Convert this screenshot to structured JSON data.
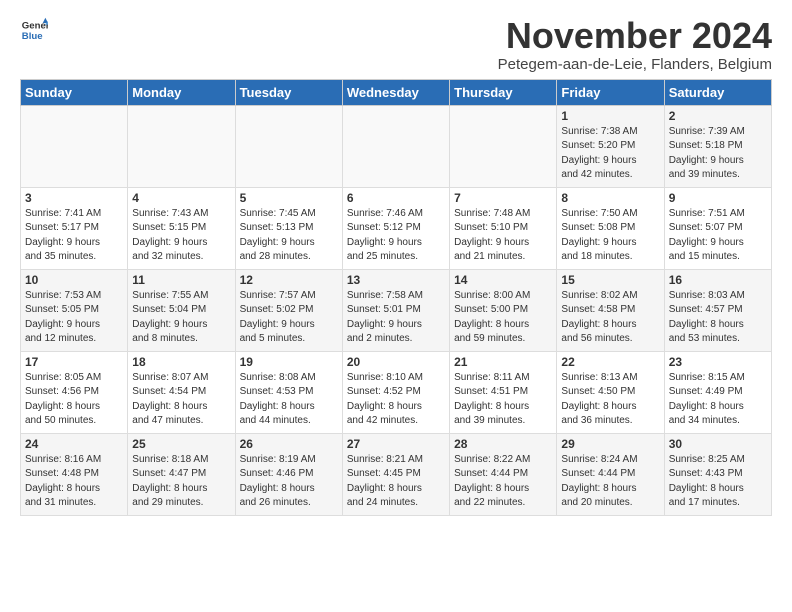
{
  "logo": {
    "line1": "General",
    "line2": "Blue"
  },
  "title": "November 2024",
  "subtitle": "Petegem-aan-de-Leie, Flanders, Belgium",
  "days_header": [
    "Sunday",
    "Monday",
    "Tuesday",
    "Wednesday",
    "Thursday",
    "Friday",
    "Saturday"
  ],
  "weeks": [
    [
      {
        "day": "",
        "info": ""
      },
      {
        "day": "",
        "info": ""
      },
      {
        "day": "",
        "info": ""
      },
      {
        "day": "",
        "info": ""
      },
      {
        "day": "",
        "info": ""
      },
      {
        "day": "1",
        "info": "Sunrise: 7:38 AM\nSunset: 5:20 PM\nDaylight: 9 hours\nand 42 minutes."
      },
      {
        "day": "2",
        "info": "Sunrise: 7:39 AM\nSunset: 5:18 PM\nDaylight: 9 hours\nand 39 minutes."
      }
    ],
    [
      {
        "day": "3",
        "info": "Sunrise: 7:41 AM\nSunset: 5:17 PM\nDaylight: 9 hours\nand 35 minutes."
      },
      {
        "day": "4",
        "info": "Sunrise: 7:43 AM\nSunset: 5:15 PM\nDaylight: 9 hours\nand 32 minutes."
      },
      {
        "day": "5",
        "info": "Sunrise: 7:45 AM\nSunset: 5:13 PM\nDaylight: 9 hours\nand 28 minutes."
      },
      {
        "day": "6",
        "info": "Sunrise: 7:46 AM\nSunset: 5:12 PM\nDaylight: 9 hours\nand 25 minutes."
      },
      {
        "day": "7",
        "info": "Sunrise: 7:48 AM\nSunset: 5:10 PM\nDaylight: 9 hours\nand 21 minutes."
      },
      {
        "day": "8",
        "info": "Sunrise: 7:50 AM\nSunset: 5:08 PM\nDaylight: 9 hours\nand 18 minutes."
      },
      {
        "day": "9",
        "info": "Sunrise: 7:51 AM\nSunset: 5:07 PM\nDaylight: 9 hours\nand 15 minutes."
      }
    ],
    [
      {
        "day": "10",
        "info": "Sunrise: 7:53 AM\nSunset: 5:05 PM\nDaylight: 9 hours\nand 12 minutes."
      },
      {
        "day": "11",
        "info": "Sunrise: 7:55 AM\nSunset: 5:04 PM\nDaylight: 9 hours\nand 8 minutes."
      },
      {
        "day": "12",
        "info": "Sunrise: 7:57 AM\nSunset: 5:02 PM\nDaylight: 9 hours\nand 5 minutes."
      },
      {
        "day": "13",
        "info": "Sunrise: 7:58 AM\nSunset: 5:01 PM\nDaylight: 9 hours\nand 2 minutes."
      },
      {
        "day": "14",
        "info": "Sunrise: 8:00 AM\nSunset: 5:00 PM\nDaylight: 8 hours\nand 59 minutes."
      },
      {
        "day": "15",
        "info": "Sunrise: 8:02 AM\nSunset: 4:58 PM\nDaylight: 8 hours\nand 56 minutes."
      },
      {
        "day": "16",
        "info": "Sunrise: 8:03 AM\nSunset: 4:57 PM\nDaylight: 8 hours\nand 53 minutes."
      }
    ],
    [
      {
        "day": "17",
        "info": "Sunrise: 8:05 AM\nSunset: 4:56 PM\nDaylight: 8 hours\nand 50 minutes."
      },
      {
        "day": "18",
        "info": "Sunrise: 8:07 AM\nSunset: 4:54 PM\nDaylight: 8 hours\nand 47 minutes."
      },
      {
        "day": "19",
        "info": "Sunrise: 8:08 AM\nSunset: 4:53 PM\nDaylight: 8 hours\nand 44 minutes."
      },
      {
        "day": "20",
        "info": "Sunrise: 8:10 AM\nSunset: 4:52 PM\nDaylight: 8 hours\nand 42 minutes."
      },
      {
        "day": "21",
        "info": "Sunrise: 8:11 AM\nSunset: 4:51 PM\nDaylight: 8 hours\nand 39 minutes."
      },
      {
        "day": "22",
        "info": "Sunrise: 8:13 AM\nSunset: 4:50 PM\nDaylight: 8 hours\nand 36 minutes."
      },
      {
        "day": "23",
        "info": "Sunrise: 8:15 AM\nSunset: 4:49 PM\nDaylight: 8 hours\nand 34 minutes."
      }
    ],
    [
      {
        "day": "24",
        "info": "Sunrise: 8:16 AM\nSunset: 4:48 PM\nDaylight: 8 hours\nand 31 minutes."
      },
      {
        "day": "25",
        "info": "Sunrise: 8:18 AM\nSunset: 4:47 PM\nDaylight: 8 hours\nand 29 minutes."
      },
      {
        "day": "26",
        "info": "Sunrise: 8:19 AM\nSunset: 4:46 PM\nDaylight: 8 hours\nand 26 minutes."
      },
      {
        "day": "27",
        "info": "Sunrise: 8:21 AM\nSunset: 4:45 PM\nDaylight: 8 hours\nand 24 minutes."
      },
      {
        "day": "28",
        "info": "Sunrise: 8:22 AM\nSunset: 4:44 PM\nDaylight: 8 hours\nand 22 minutes."
      },
      {
        "day": "29",
        "info": "Sunrise: 8:24 AM\nSunset: 4:44 PM\nDaylight: 8 hours\nand 20 minutes."
      },
      {
        "day": "30",
        "info": "Sunrise: 8:25 AM\nSunset: 4:43 PM\nDaylight: 8 hours\nand 17 minutes."
      }
    ]
  ]
}
